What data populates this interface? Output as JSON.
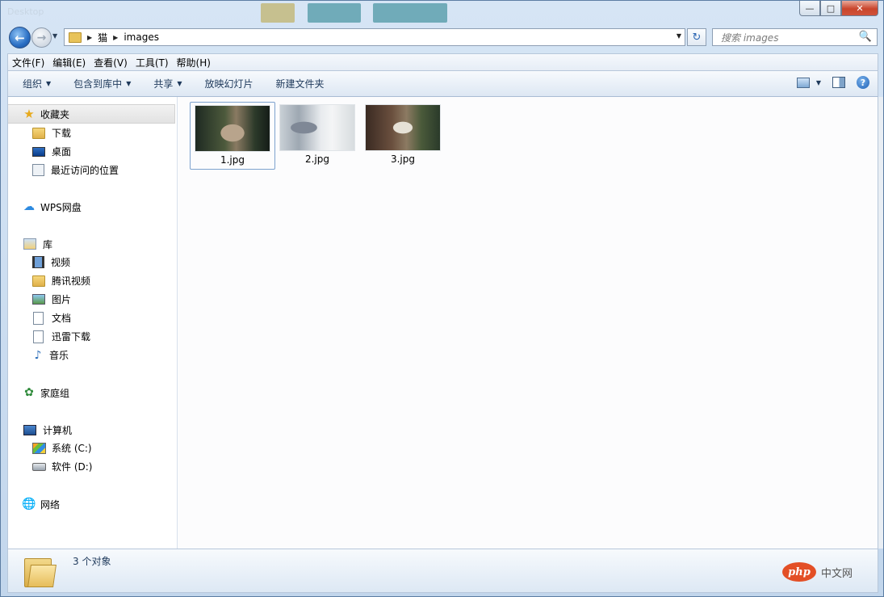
{
  "window": {
    "title": "Desktop",
    "buttons": {
      "minimize": "—",
      "maximize": "□",
      "close": "✕"
    }
  },
  "nav": {
    "back_icon": "←",
    "forward_icon": "→",
    "breadcrumb": [
      "猫",
      "images"
    ],
    "refresh_icon": "↻",
    "search_placeholder": "搜索 images",
    "search_icon": "🔍"
  },
  "menu": [
    "文件(F)",
    "编辑(E)",
    "查看(V)",
    "工具(T)",
    "帮助(H)"
  ],
  "commands": {
    "organize": "组织",
    "include_library": "包含到库中",
    "share": "共享",
    "slideshow": "放映幻灯片",
    "new_folder": "新建文件夹",
    "help_icon": "?"
  },
  "sidebar": {
    "favorites": {
      "label": "收藏夹",
      "items": [
        "下载",
        "桌面",
        "最近访问的位置"
      ]
    },
    "cloud": {
      "label": "WPS网盘"
    },
    "libraries": {
      "label": "库",
      "items": [
        "视频",
        "腾讯视频",
        "图片",
        "文档",
        "迅雷下载",
        "音乐"
      ]
    },
    "homegroup": {
      "label": "家庭组"
    },
    "computer": {
      "label": "计算机",
      "items": [
        "系统 (C:)",
        "软件 (D:)"
      ]
    },
    "network": {
      "label": "网络"
    }
  },
  "files": [
    {
      "name": "1.jpg",
      "selected": true
    },
    {
      "name": "2.jpg",
      "selected": false
    },
    {
      "name": "3.jpg",
      "selected": false
    }
  ],
  "status": {
    "count_text": "3 个对象"
  },
  "watermark": {
    "logo": "php",
    "text": "中文网"
  }
}
